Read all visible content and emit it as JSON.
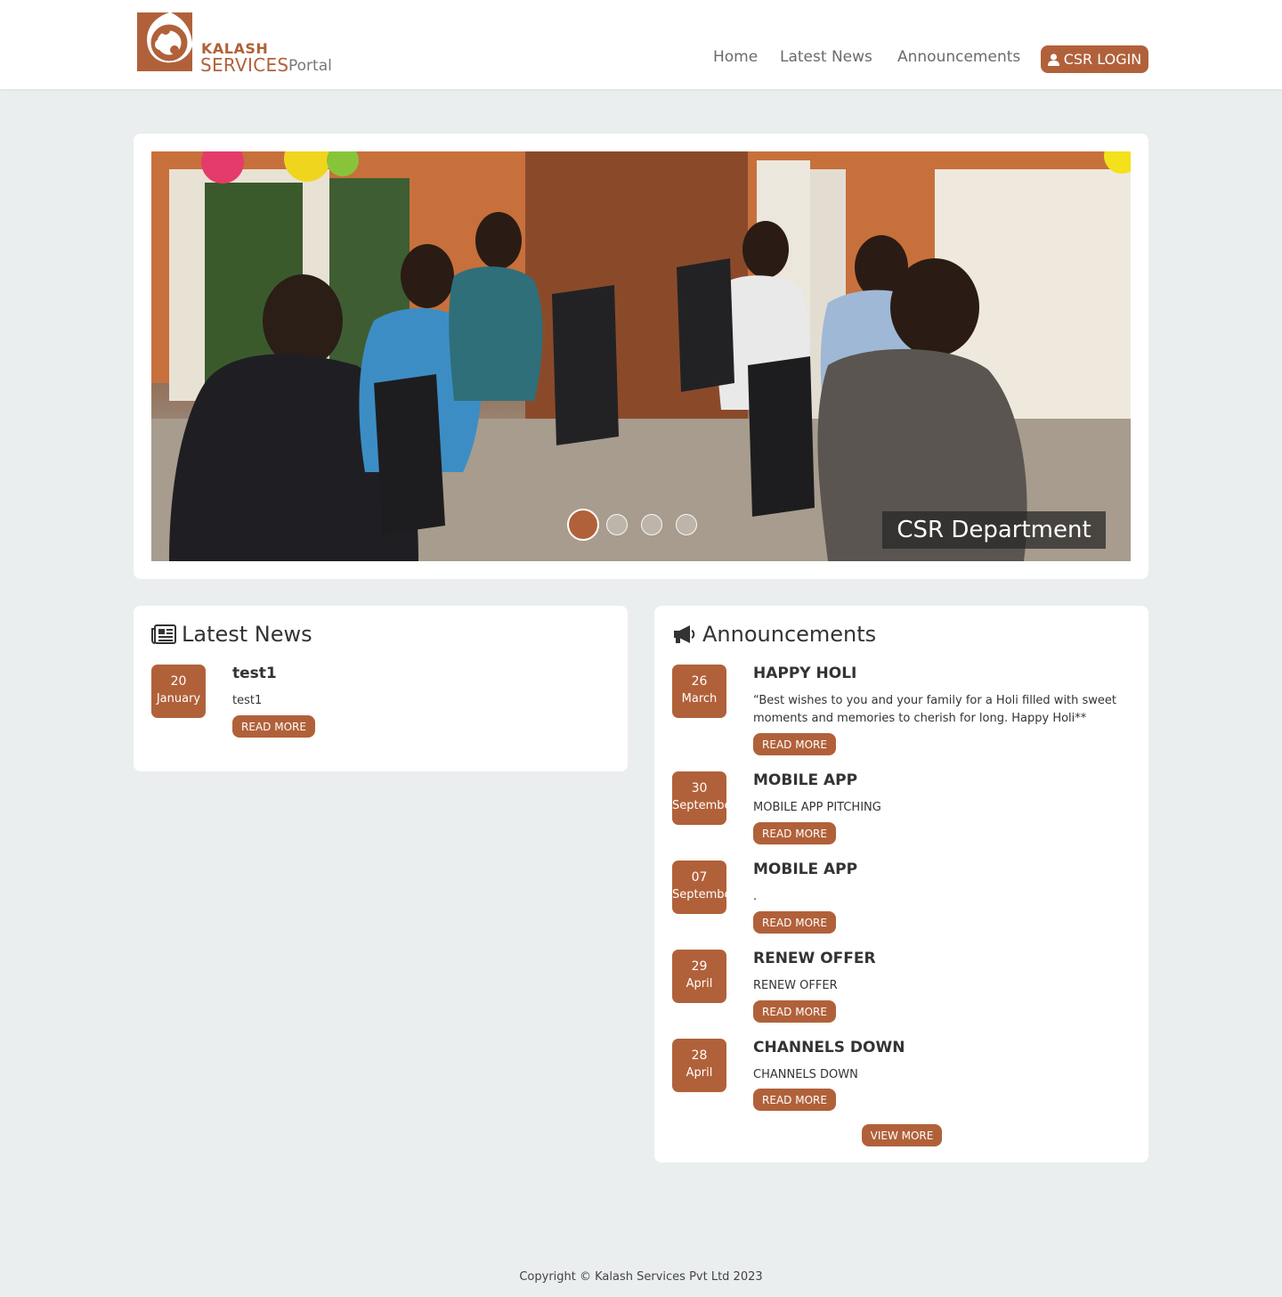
{
  "header": {
    "logo_kalash": "KALASH",
    "logo_services": "SERVICES",
    "logo_portal": "Portal",
    "nav": [
      {
        "label": "Home"
      },
      {
        "label": "Latest News"
      },
      {
        "label": "Announcements"
      }
    ],
    "login_label": "CSR LOGIN",
    "brand_color": "#b1613a"
  },
  "slider": {
    "caption": "CSR Department",
    "slide_count": 4,
    "active_slide": 1
  },
  "latest_news": {
    "title": "Latest News",
    "items": [
      {
        "day": "20",
        "month": "January",
        "title": "test1",
        "desc": "test1",
        "read_more": "READ MORE"
      }
    ]
  },
  "announcements": {
    "title": "Announcements",
    "items": [
      {
        "day": "26",
        "month": "March",
        "title": "HAPPY HOLI",
        "desc": "“Best wishes to you and your family for a Holi filled with sweet moments and memories to cherish for long. Happy Holi**",
        "read_more": "READ MORE"
      },
      {
        "day": "30",
        "month": "September",
        "title": "MOBILE APP",
        "desc": "MOBILE APP PITCHING",
        "read_more": "READ MORE"
      },
      {
        "day": "07",
        "month": "September",
        "title": "MOBILE APP",
        "desc": ".",
        "read_more": "READ MORE"
      },
      {
        "day": "29",
        "month": "April",
        "title": "RENEW OFFER",
        "desc": "RENEW OFFER",
        "read_more": "READ MORE"
      },
      {
        "day": "28",
        "month": "April",
        "title": "CHANNELS DOWN",
        "desc": "CHANNELS DOWN",
        "read_more": "READ MORE"
      }
    ],
    "view_more": "VIEW MORE"
  },
  "footer": {
    "copyright": "Copyright © Kalash Services Pvt Ltd 2023"
  }
}
